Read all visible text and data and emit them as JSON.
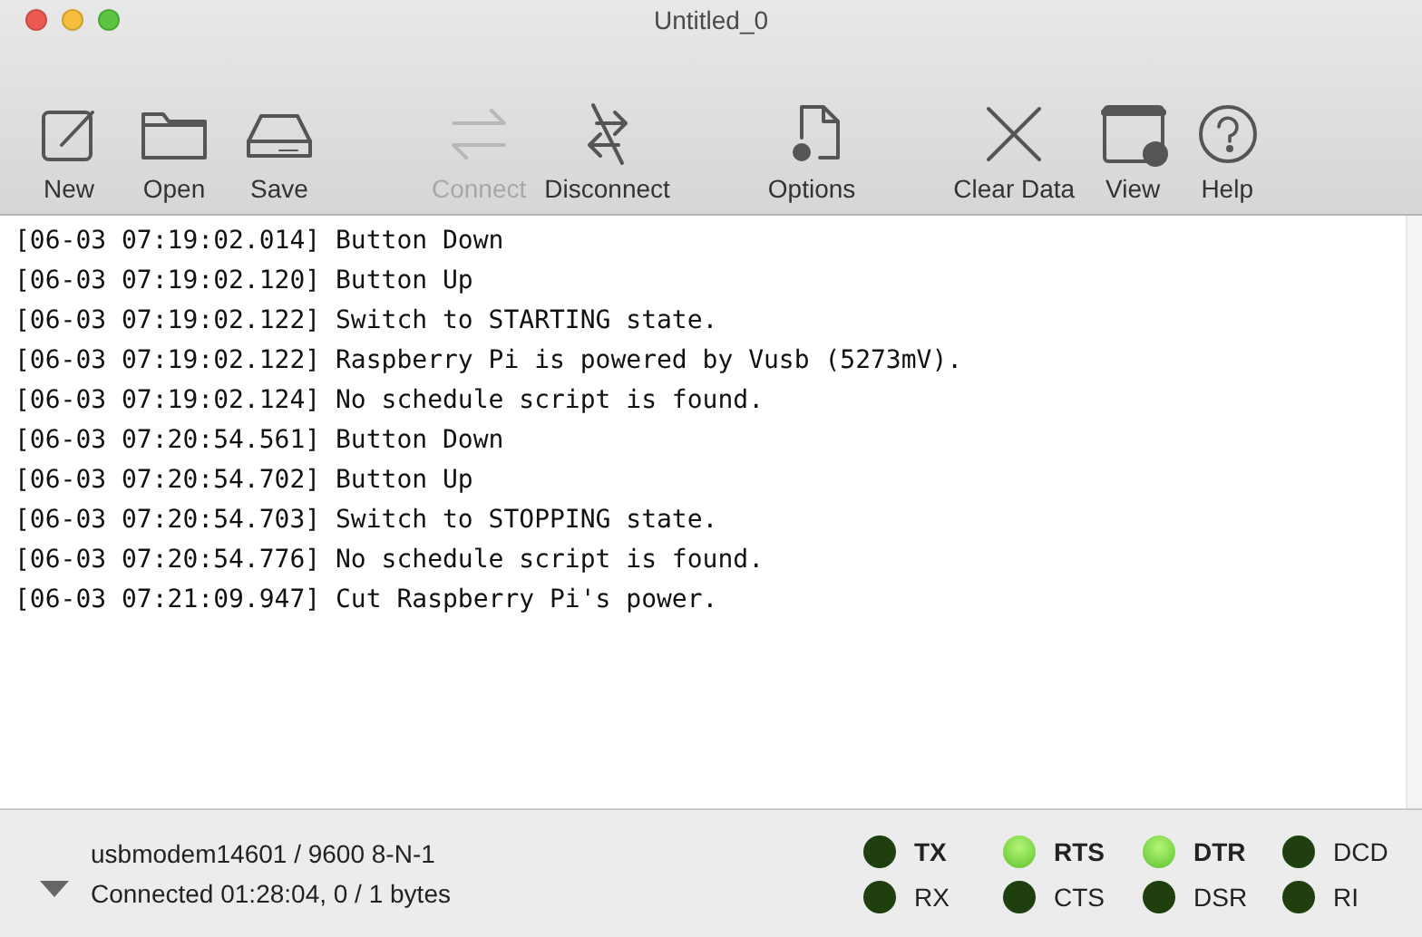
{
  "window": {
    "title": "Untitled_0"
  },
  "toolbar": {
    "groups": [
      [
        {
          "label": "New",
          "disabled": false
        },
        {
          "label": "Open",
          "disabled": false
        },
        {
          "label": "Save",
          "disabled": false
        }
      ],
      [
        {
          "label": "Connect",
          "disabled": true
        },
        {
          "label": "Disconnect",
          "disabled": false
        }
      ],
      [
        {
          "label": "Options",
          "disabled": false
        }
      ],
      [
        {
          "label": "Clear Data",
          "disabled": false
        },
        {
          "label": "View",
          "disabled": false
        },
        {
          "label": "Help",
          "disabled": false
        }
      ]
    ]
  },
  "log": [
    "[06-03 07:19:02.014] Button Down",
    "[06-03 07:19:02.120] Button Up",
    "[06-03 07:19:02.122] Switch to STARTING state.",
    "[06-03 07:19:02.122] Raspberry Pi is powered by Vusb (5273mV).",
    "[06-03 07:19:02.124] No schedule script is found.",
    "[06-03 07:20:54.561] Button Down",
    "[06-03 07:20:54.702] Button Up",
    "[06-03 07:20:54.703] Switch to STOPPING state.",
    "[06-03 07:20:54.776] No schedule script is found.",
    "[06-03 07:21:09.947] Cut Raspberry Pi's power."
  ],
  "status_bar": {
    "port": "usbmodem14601 / 9600 8-N-1",
    "connection": "Connected 01:28:04, 0 / 1 bytes",
    "signals": [
      {
        "label": "TX",
        "kind": "output",
        "on": false
      },
      {
        "label": "RX",
        "kind": "input",
        "on": false
      },
      {
        "label": "RTS",
        "kind": "output",
        "on": true
      },
      {
        "label": "CTS",
        "kind": "input",
        "on": false
      },
      {
        "label": "DTR",
        "kind": "output",
        "on": true
      },
      {
        "label": "DSR",
        "kind": "input",
        "on": false
      },
      {
        "label": "DCD",
        "kind": "input",
        "on": false
      },
      {
        "label": "RI",
        "kind": "input",
        "on": false
      }
    ]
  }
}
